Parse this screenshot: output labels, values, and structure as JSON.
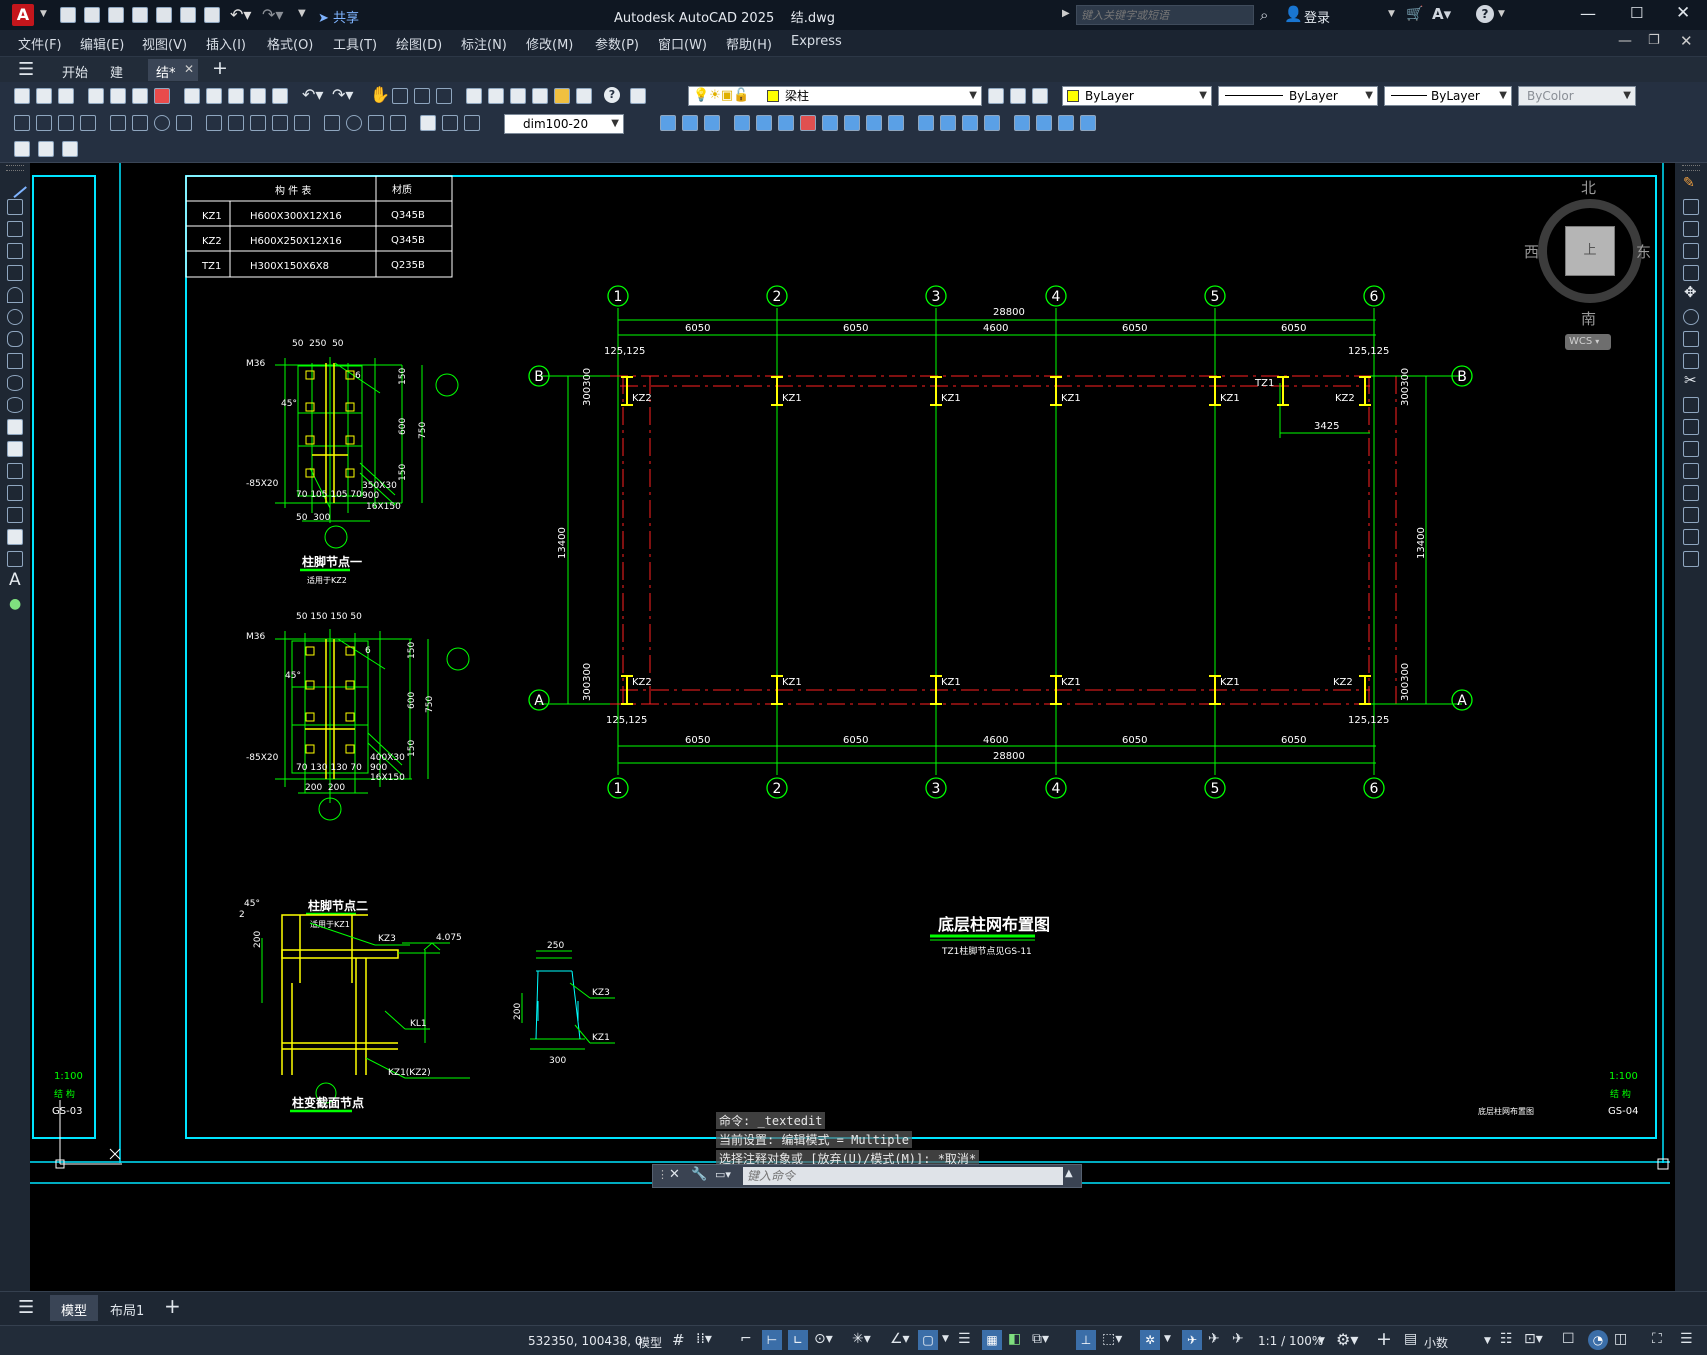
{
  "window": {
    "title": "Autodesk AutoCAD 2025    结.dwg",
    "app_icon": "A",
    "share_label": "共享",
    "search_placeholder": "键入关键字或短语",
    "login_label": "登录",
    "help_icon": "question-icon"
  },
  "menu": {
    "items": [
      "文件(F)",
      "编辑(E)",
      "视图(V)",
      "插入(I)",
      "格式(O)",
      "工具(T)",
      "绘图(D)",
      "标注(N)",
      "修改(M)",
      "参数(P)",
      "窗口(W)",
      "帮助(H)",
      "Express"
    ]
  },
  "doc_tabs": {
    "items": [
      "开始",
      "建",
      "结*"
    ]
  },
  "toolbar": {
    "layer_value": "梁柱",
    "color_value": "ByLayer",
    "linetype_value": "ByLayer",
    "lineweight_value": "ByLayer",
    "plotstyle_value": "ByColor",
    "dimstyle_value": "dim100-20"
  },
  "viewcube": {
    "north": "北",
    "south": "南",
    "east": "东",
    "west": "西",
    "face": "上",
    "wcs": "WCS"
  },
  "drawing": {
    "member_table": {
      "headers": [
        "构 件 表",
        "材质"
      ],
      "rows": [
        [
          "KZ1",
          "H600X300X12X16",
          "Q345B"
        ],
        [
          "KZ2",
          "H600X250X12X16",
          "Q345B"
        ],
        [
          "TZ1",
          "H300X150X6X8",
          "Q235B"
        ]
      ]
    },
    "grid_numbers": [
      "1",
      "2",
      "3",
      "4",
      "5",
      "6"
    ],
    "grid_letters": [
      "B",
      "A"
    ],
    "dims": {
      "total": "28800",
      "spans": [
        "6050",
        "6050",
        "4600",
        "6050",
        "6050"
      ],
      "height": "13400",
      "offset_125": "125,125",
      "offset_300": "300300",
      "tz_dim": "3425"
    },
    "column_labels": {
      "top": [
        "KZ2",
        "KZ1",
        "KZ1",
        "KZ1",
        "KZ1",
        "KZ2"
      ],
      "bottom": [
        "KZ2",
        "KZ1",
        "KZ1",
        "KZ1",
        "KZ1",
        "KZ2"
      ],
      "tz": "TZ1"
    },
    "main_title": "底层柱网布置图",
    "main_subtitle": "TZ1柱脚节点见GS-11",
    "detail1": {
      "title": "柱脚节点一",
      "subtitle": "适用于KZ2",
      "dims_top": "50  250  50",
      "dims_bottom": "50  300",
      "labels": [
        "350X30",
        "900",
        "16X150",
        "-85X20",
        "70 105 105 70",
        "45°",
        "6"
      ],
      "side_dims": [
        "150",
        "600",
        "750",
        "150"
      ],
      "left_label": "M36"
    },
    "detail2": {
      "title": "柱脚节点二",
      "subtitle": "适用于KZ1",
      "dims_top": "50 150 150 50",
      "dims_bottom": "200  200",
      "labels": [
        "400X30",
        "900",
        "16X150",
        "-85X20",
        "70 130 130 70",
        "45°",
        "6"
      ],
      "side_dims": [
        "150",
        "600",
        "750",
        "150"
      ],
      "left_label": "M36"
    },
    "detail3": {
      "title": "柱变截面节点",
      "labels": [
        "KZ3",
        "KL1",
        "KZ1(KZ2)",
        "4.075",
        "200",
        "45°",
        "2"
      ]
    },
    "detail4": {
      "labels": [
        "250",
        "KZ3",
        "KZ1",
        "300",
        "200"
      ]
    },
    "left_sheet": {
      "scale": "1:100",
      "name": "结 构",
      "code": "GS-03"
    },
    "right_sheet": {
      "scale": "1:100",
      "name": "结 构",
      "title": "底层柱网布置图",
      "code": "GS-04"
    }
  },
  "command": {
    "history": [
      "命令: _textedit",
      "当前设置: 编辑模式 = Multiple",
      "选择注释对象或 [放弃(U)/模式(M)]: *取消*"
    ],
    "placeholder": "键入命令"
  },
  "layout_tabs": {
    "items": [
      "模型",
      "布局1"
    ]
  },
  "status": {
    "coords": "532350, 100438, 0",
    "model": "模型",
    "scale": "1:1 / 100%",
    "units": "小数"
  },
  "colors": {
    "grid_green": "#00ff00",
    "axis_red": "#ff2020",
    "column_yellow": "#ffff00",
    "frame_cyan": "#00e5ff",
    "ui_dark": "#1e2733"
  }
}
